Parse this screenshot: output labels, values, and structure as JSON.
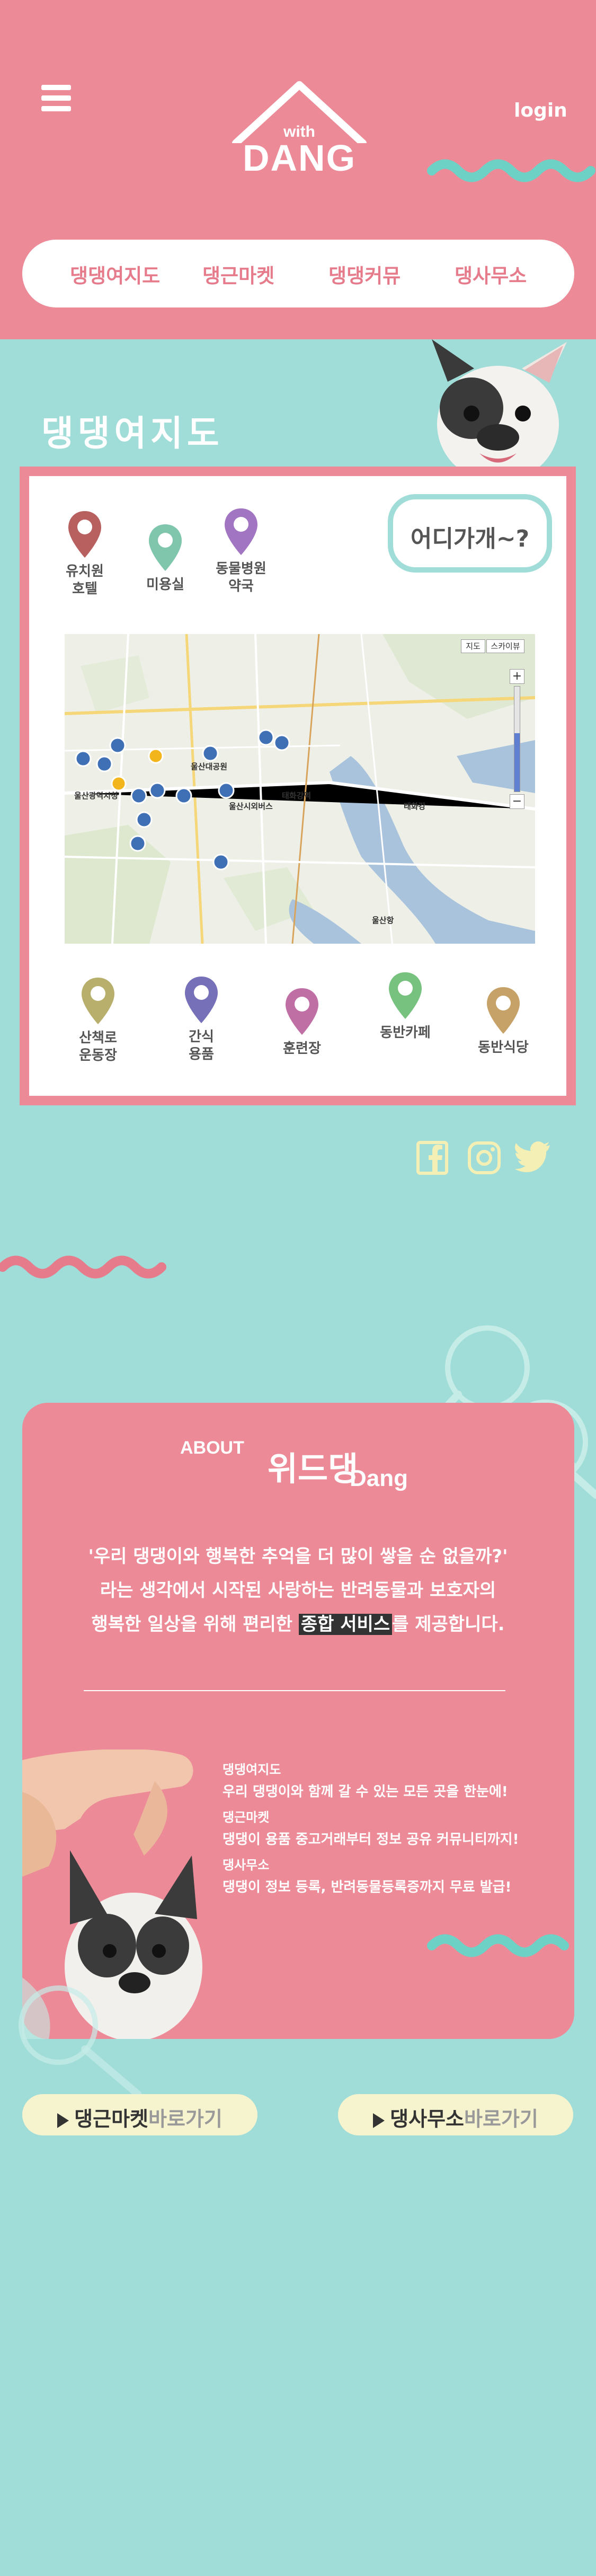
{
  "header": {
    "logo_with": "with",
    "logo_name": "DANG",
    "login_label": "login",
    "nav": [
      "댕댕여지도",
      "댕근마켓",
      "댕댕커뮤",
      "댕사무소"
    ]
  },
  "map_section": {
    "title": "댕댕여지도",
    "bubble": "어디가개~?",
    "top_pins": [
      {
        "label": "유치원\n호텔",
        "color": "#b85f5f"
      },
      {
        "label": "미용실",
        "color": "#7fc6ad"
      },
      {
        "label": "동물병원\n약국",
        "color": "#a175c2"
      }
    ],
    "bottom_pins": [
      {
        "label": "산책로\n운동장",
        "color": "#b7af6b"
      },
      {
        "label": "간식\n용품",
        "color": "#7570b8"
      },
      {
        "label": "훈련장",
        "color": "#c06fa5"
      },
      {
        "label": "동반카페",
        "color": "#78c27f"
      },
      {
        "label": "동반식당",
        "color": "#c7a268"
      }
    ],
    "map": {
      "btn_map": "지도",
      "btn_sky": "스카이뷰",
      "labels": [
        "울산광역시청",
        "울산대공원",
        "울산시외버스",
        "태화강역",
        "울산항",
        "태화강"
      ]
    }
  },
  "social": {
    "icons": [
      "facebook-icon",
      "instagram-icon",
      "twitter-icon"
    ]
  },
  "about": {
    "about_label": "ABOUT",
    "brand": "위드댕",
    "brand_sub": "Dang",
    "line1": "'우리 댕댕이와 행복한 추억을 더 많이 쌓을 순 없을까?'",
    "line2": "라는 생각에서 시작된 사랑하는 반려동물과 보호자의",
    "line3_pre": "행복한 일상을 위해 편리한 ",
    "line3_highlight": "종합 서비스",
    "line3_post": "를 제공합니다.",
    "features": [
      {
        "title": "댕댕여지도",
        "desc": "우리 댕댕이와 함께 갈 수 있는 모든 곳을 한눈에!"
      },
      {
        "title": "댕근마켓",
        "desc": "댕댕이 용품 중고거래부터 정보 공유 커뮤니티까지!"
      },
      {
        "title": "댕사무소",
        "desc": "댕댕이 정보 등록, 반려동물등록증까지 무료 발급!"
      }
    ]
  },
  "buttons": [
    {
      "main": "댕근마켓",
      "sub": "바로가기"
    },
    {
      "main": "댕사무소",
      "sub": "바로가기"
    }
  ],
  "colors": {
    "pink": "#ec8b97",
    "mint": "#a0ddd8",
    "nav_text": "#e67b8b",
    "cream": "#f6f3cf"
  }
}
